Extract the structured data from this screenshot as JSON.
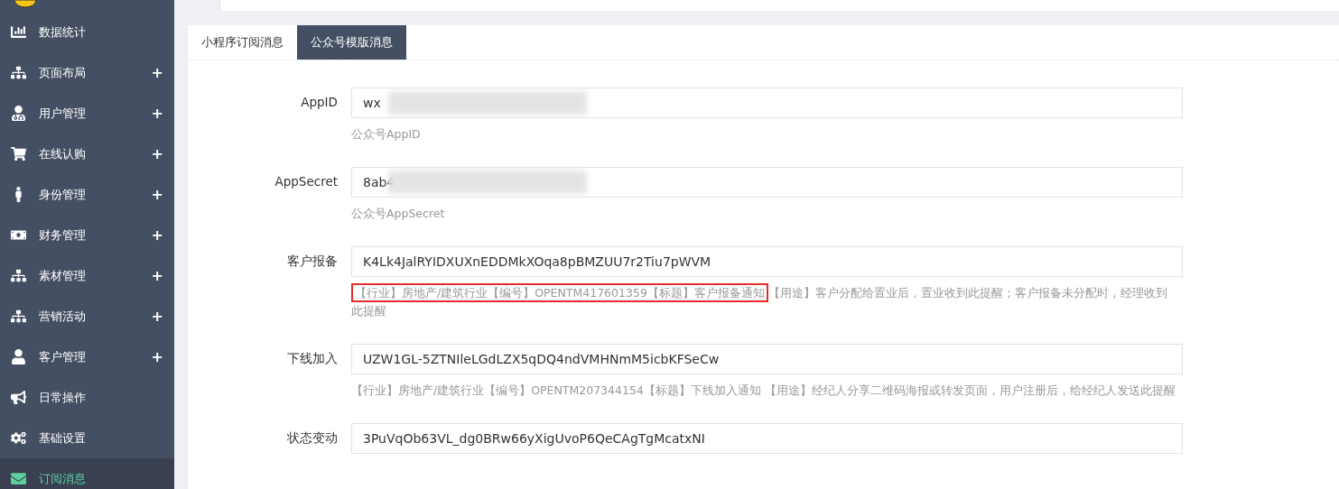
{
  "sidebar": {
    "items": [
      {
        "label": "数据统计",
        "selected": false
      },
      {
        "label": "页面布局",
        "expand_mark": "+",
        "selected": false
      },
      {
        "label": "用户管理",
        "expand_mark": "+",
        "selected": false
      },
      {
        "label": "在线认购",
        "expand_mark": "+",
        "selected": false
      },
      {
        "label": "身份管理",
        "expand_mark": "+",
        "selected": false
      },
      {
        "label": "财务管理",
        "expand_mark": "+",
        "selected": false
      },
      {
        "label": "素材管理",
        "expand_mark": "+",
        "selected": false
      },
      {
        "label": "营销活动",
        "expand_mark": "+",
        "selected": false
      },
      {
        "label": "客户管理",
        "expand_mark": "+",
        "selected": false
      },
      {
        "label": "日常操作",
        "selected": false
      },
      {
        "label": "基础设置",
        "selected": false
      },
      {
        "label": "订阅消息",
        "selected": true
      }
    ]
  },
  "tabs": [
    {
      "label": "小程序订阅消息",
      "selected": false
    },
    {
      "label": "公众号模版消息",
      "selected": true
    }
  ],
  "fields": [
    {
      "label": "AppID",
      "value": "wx",
      "redacted": true,
      "hint": {
        "text": "公众号AppID"
      }
    },
    {
      "label": "AppSecret",
      "value": "8ab4",
      "redacted": true,
      "hint": {
        "text": "公众号AppSecret"
      }
    },
    {
      "label": "客户报备",
      "value": "K4Lk4JalRYIDXUXnEDDMkXOqa8pBMZUU7r2Tiu7pWVM",
      "hint": {
        "highlighted": "【行业】房地产/建筑行业【编号】OPENTM417601359【标题】客户报备通知",
        "text": "【用途】客户分配给置业后，置业收到此提醒；客户报备未分配时，经理收到此提醒"
      }
    },
    {
      "label": "下线加入",
      "value": "UZW1GL-5ZTNIleLGdLZX5qDQ4ndVMHNmM5icbKFSeCw",
      "hint": {
        "text": "【行业】房地产/建筑行业【编号】OPENTM207344154【标题】下线加入通知 【用途】经纪人分享二维码海报或转发页面，用户注册后，给经纪人发送此提醒"
      }
    },
    {
      "label": "状态变动",
      "value": "3PuVqOb63VL_dg0BRw66yXigUvoP6QeCAgTgMcatxNI"
    }
  ]
}
